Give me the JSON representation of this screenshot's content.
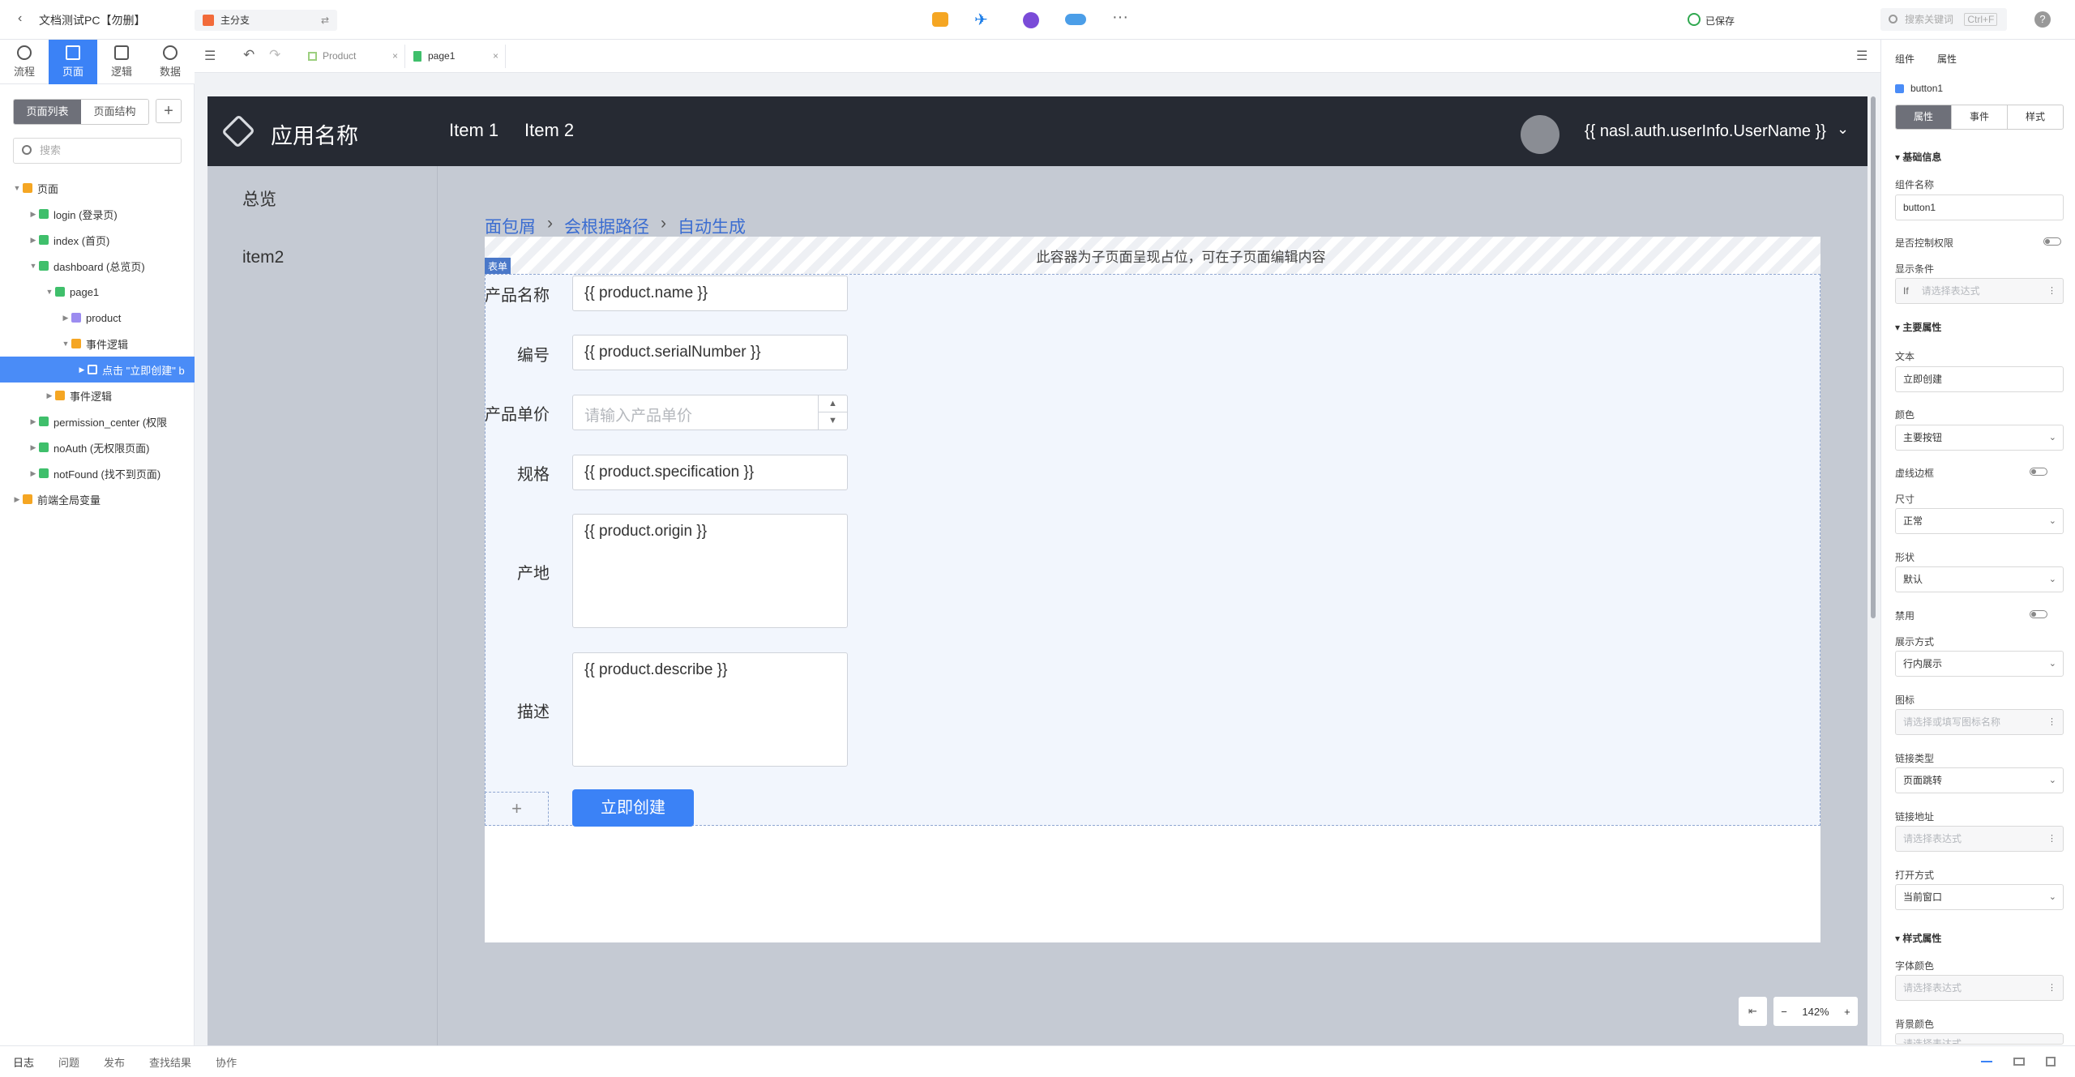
{
  "topbar": {
    "back_icon": "chevron-left-icon",
    "app_title": "文档测试PC【勿删】",
    "branch_label": "主分支",
    "saved_status": "已保存",
    "search_placeholder": "搜索关键词",
    "search_shortcut": "Ctrl+F",
    "help_icon": "help-icon"
  },
  "left_tabs": [
    {
      "label": "流程",
      "icon": "flow-icon"
    },
    {
      "label": "页面",
      "icon": "page-icon",
      "active": true
    },
    {
      "label": "逻辑",
      "icon": "logic-icon"
    },
    {
      "label": "数据",
      "icon": "data-icon"
    }
  ],
  "left_panel": {
    "seg_list": "页面列表",
    "seg_structure": "页面结构",
    "add_label": "+",
    "search_placeholder": "搜索",
    "tree": [
      {
        "label": "页面",
        "level": 0,
        "icon": "folder",
        "expanded": true
      },
      {
        "label": "login (登录页)",
        "level": 1,
        "icon": "page"
      },
      {
        "label": "index (首页)",
        "level": 1,
        "icon": "page"
      },
      {
        "label": "dashboard (总览页)",
        "level": 1,
        "icon": "page",
        "expanded": true
      },
      {
        "label": "page1",
        "level": 2,
        "icon": "page",
        "expanded": true
      },
      {
        "label": "product",
        "level": 3,
        "icon": "comp"
      },
      {
        "label": "事件逻辑",
        "level": 3,
        "icon": "folder",
        "expanded": true
      },
      {
        "label": "点击 \"立即创建\" b",
        "level": 4,
        "icon": "ev",
        "selected": true
      },
      {
        "label": "事件逻辑",
        "level": 2,
        "icon": "folder"
      },
      {
        "label": "permission_center (权限",
        "level": 1,
        "icon": "page"
      },
      {
        "label": "noAuth (无权限页面)",
        "level": 1,
        "icon": "page"
      },
      {
        "label": "notFound (找不到页面)",
        "level": 1,
        "icon": "page"
      },
      {
        "label": "前端全局变量",
        "level": 0,
        "icon": "folder"
      }
    ]
  },
  "editor_tabs": [
    {
      "label": "Product",
      "active": false
    },
    {
      "label": "page1",
      "active": true
    }
  ],
  "app_preview": {
    "app_name": "应用名称",
    "nav_items": [
      "Item 1",
      "Item 2"
    ],
    "username": "{{ nasl.auth.userInfo.UserName }}",
    "side_items": [
      "总览",
      "item2"
    ],
    "breadcrumb": [
      "面包屑",
      "会根据路径",
      "自动生成"
    ],
    "placeholder_text": "此容器为子页面呈现占位，可在子页面编辑内容",
    "form_tag": "表单",
    "form_fields": [
      {
        "label": "产品名称",
        "value": "{{ product.name }}"
      },
      {
        "label": "编号",
        "value": "{{ product.serialNumber }}"
      },
      {
        "label": "产品单价",
        "placeholder": "请输入产品单价"
      },
      {
        "label": "规格",
        "value": "{{ product.specification }}"
      },
      {
        "label": "产地",
        "value": "{{ product.origin }}"
      },
      {
        "label": "描述",
        "value": "{{ product.describe }}"
      }
    ],
    "add_symbol": "+",
    "submit_label": "立即创建"
  },
  "zoom": {
    "value": "142%",
    "minus": "−",
    "plus": "+"
  },
  "right_panel": {
    "tab_component": "组件",
    "tab_property": "属性",
    "selected_name": "button1",
    "subtabs": [
      "属性",
      "事件",
      "样式"
    ],
    "basic_section": "基础信息",
    "name_label": "组件名称",
    "name_value": "button1",
    "permission_label": "是否控制权限",
    "display_condition_label": "显示条件",
    "display_condition_prefix": "If",
    "display_condition_placeholder": "请选择表达式",
    "main_section": "主要属性",
    "text_label": "文本",
    "text_value": "立即创建",
    "color_label": "颜色",
    "color_value": "主要按钮",
    "dashed_label": "虚线边框",
    "size_label": "尺寸",
    "size_value": "正常",
    "shape_label": "形状",
    "shape_value": "默认",
    "disabled_label": "禁用",
    "display_mode_label": "展示方式",
    "display_mode_value": "行内展示",
    "icon_label": "图标",
    "icon_placeholder": "请选择或填写图标名称",
    "link_type_label": "链接类型",
    "link_type_value": "页面跳转",
    "link_addr_label": "链接地址",
    "link_addr_placeholder": "请选择表达式",
    "open_mode_label": "打开方式",
    "open_mode_value": "当前窗口",
    "style_section": "样式属性",
    "font_color_label": "字体颜色",
    "font_color_placeholder": "请选择表达式",
    "bg_color_label": "背景颜色",
    "bg_color_placeholder": "请选择表达式"
  },
  "bottom_tabs": [
    "日志",
    "问题",
    "发布",
    "查找结果",
    "协作"
  ],
  "colors": {
    "accent": "#3b82f6",
    "app_header": "#262a33",
    "frame": "#c5cad3"
  }
}
